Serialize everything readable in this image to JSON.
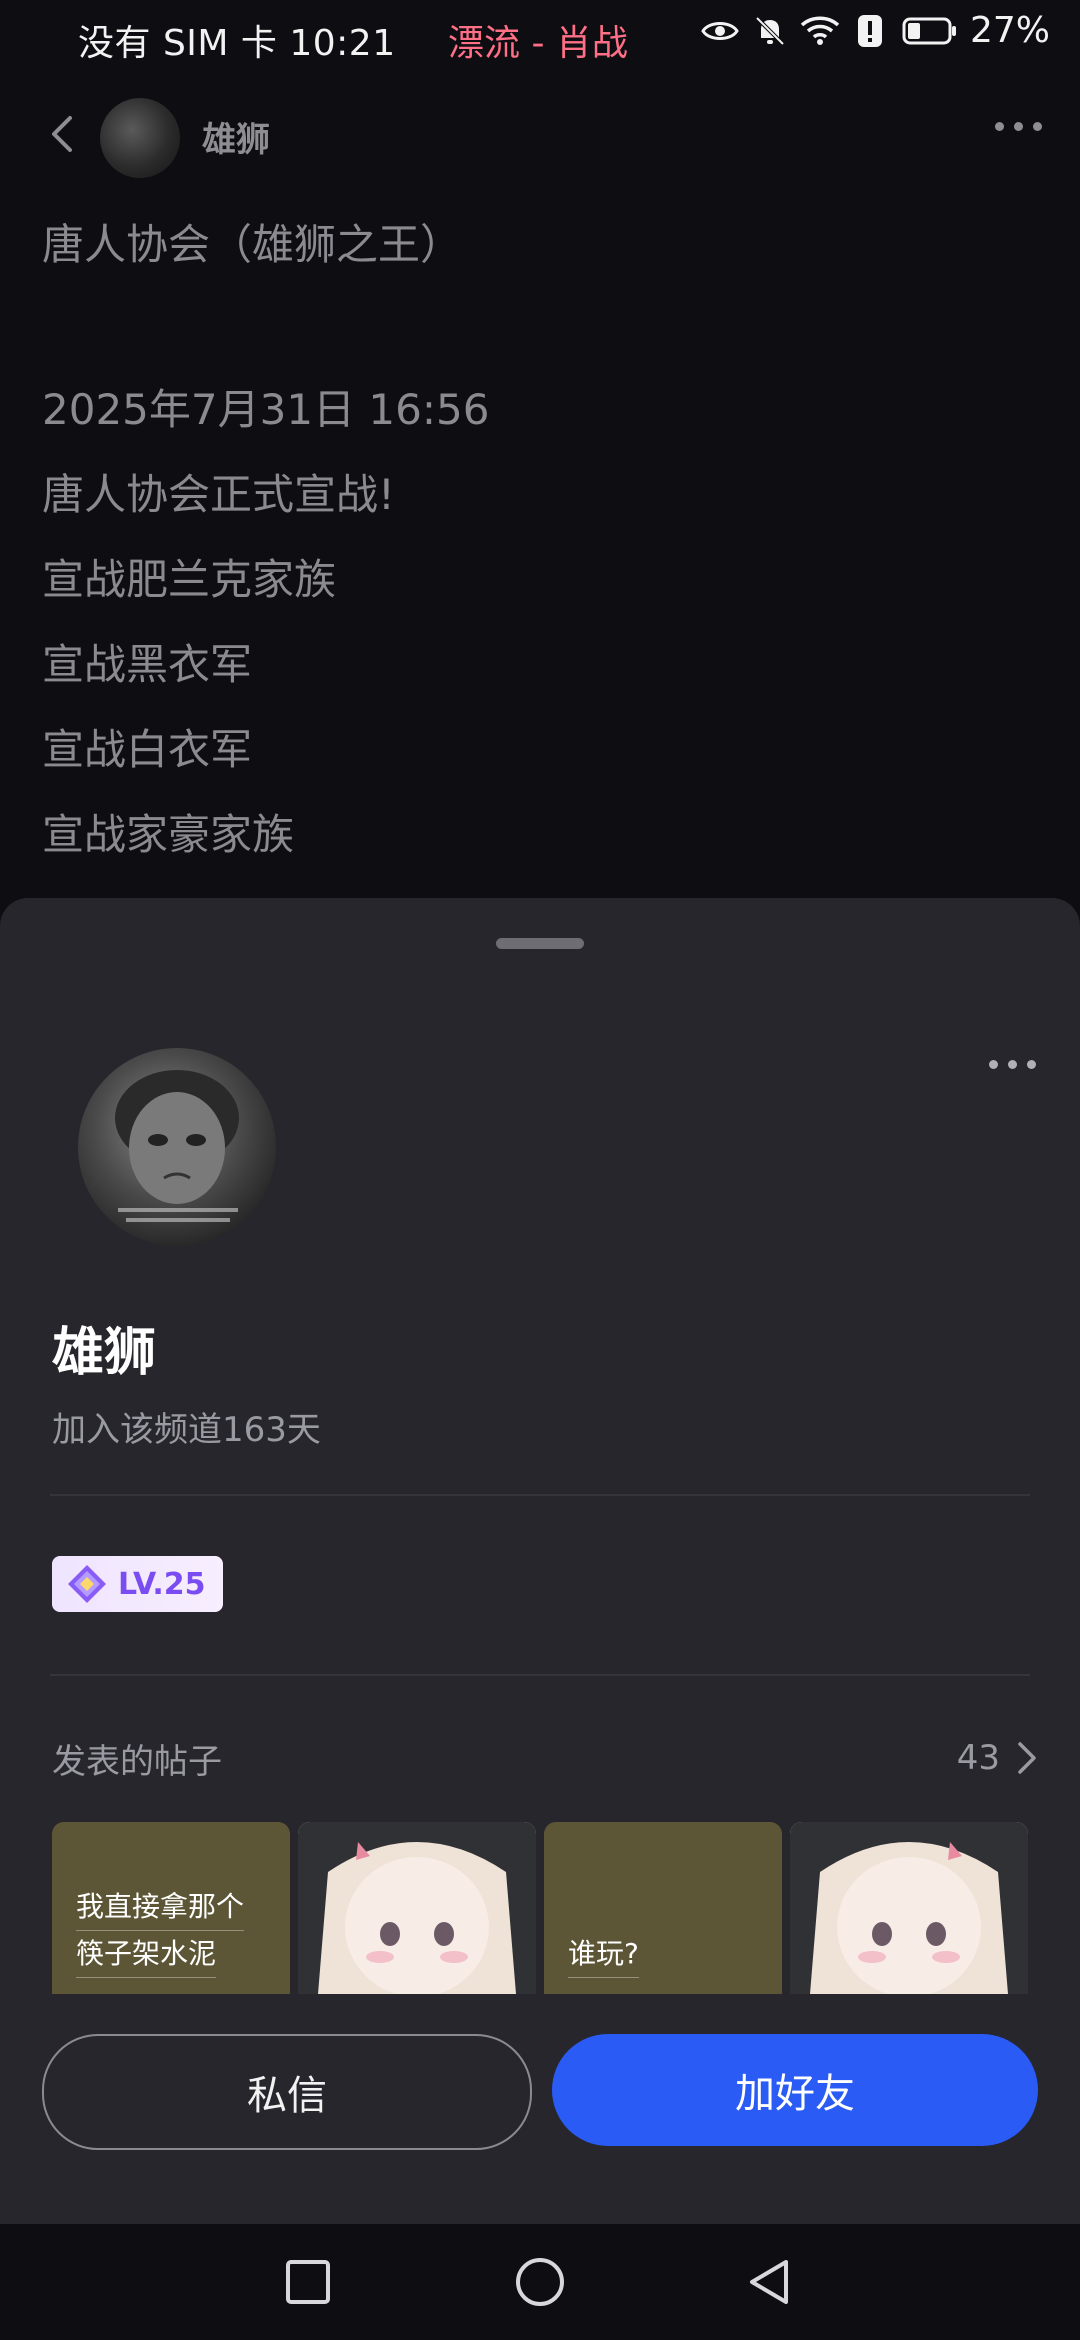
{
  "status_bar": {
    "left_text": "没有 SIM 卡 10:21",
    "music": "漂流 - 肖战",
    "battery": "27%",
    "icons": [
      "eye-icon",
      "bell-off-icon",
      "wifi-icon",
      "alert-icon",
      "battery-icon"
    ]
  },
  "nav": {
    "title": "雄狮",
    "icons": [
      "back-icon",
      "more-icon"
    ]
  },
  "post": {
    "lines_before_gap": [
      "唐人协会（雄狮之王）"
    ],
    "lines": [
      "2025年7月31日 16:56",
      "唐人协会正式宣战!",
      "宣战肥兰克家族",
      "宣战黑衣军",
      "宣战白衣军",
      "宣战家豪家族"
    ]
  },
  "profile": {
    "name": "雄狮",
    "joined": "加入该频道163天",
    "level": "LV.25",
    "posts_label": "发表的帖子",
    "posts_count": "43",
    "thumbnails": [
      {
        "type": "text",
        "lines": [
          "我直接拿那个",
          "筷子架水泥"
        ]
      },
      {
        "type": "image"
      },
      {
        "type": "text",
        "lines": [
          "谁玩?"
        ]
      },
      {
        "type": "image"
      }
    ],
    "buttons": {
      "message": "私信",
      "add_friend": "加好友"
    }
  },
  "colors": {
    "background": "#0d0d12",
    "sheet": "#26262c",
    "accent": "#2a5cf5",
    "level_text": "#7a4df2",
    "music_text": "#ff6f86"
  },
  "system_nav": [
    "recents-icon",
    "home-icon",
    "back-triangle-icon"
  ]
}
